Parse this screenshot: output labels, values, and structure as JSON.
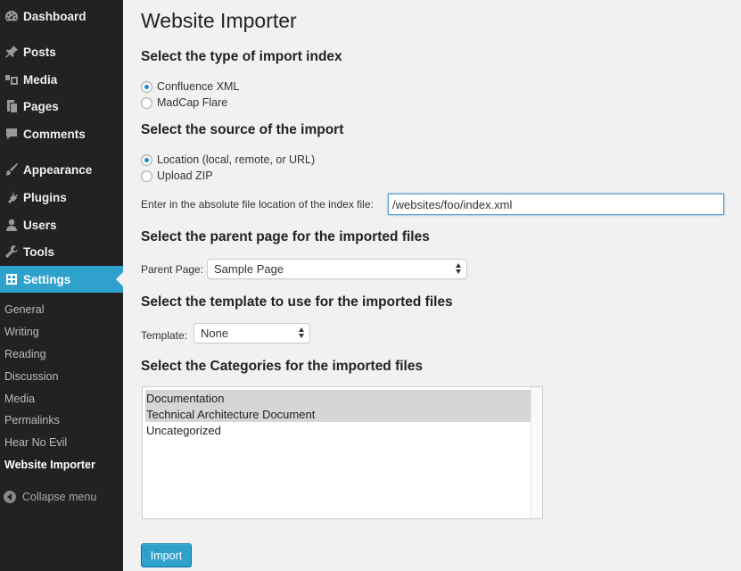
{
  "sidebar": {
    "menu": [
      {
        "label": "Dashboard",
        "icon": "dashboard-icon"
      },
      {
        "label": "Posts",
        "icon": "pin-icon"
      },
      {
        "label": "Media",
        "icon": "media-icon"
      },
      {
        "label": "Pages",
        "icon": "pages-icon"
      },
      {
        "label": "Comments",
        "icon": "comment-icon"
      },
      {
        "label": "Appearance",
        "icon": "brush-icon"
      },
      {
        "label": "Plugins",
        "icon": "plugin-icon"
      },
      {
        "label": "Users",
        "icon": "user-icon"
      },
      {
        "label": "Tools",
        "icon": "wrench-icon"
      },
      {
        "label": "Settings",
        "icon": "settings-icon"
      }
    ],
    "submenu": [
      "General",
      "Writing",
      "Reading",
      "Discussion",
      "Media",
      "Permalinks",
      "Hear No Evil",
      "Website Importer"
    ],
    "current_submenu": "Website Importer",
    "collapse_label": "Collapse menu",
    "accent_color": "#2ea2cc"
  },
  "main": {
    "title": "Website Importer",
    "import_type": {
      "heading": "Select the type of import index",
      "options": [
        "Confluence XML",
        "MadCap Flare"
      ],
      "selected": "Confluence XML"
    },
    "source": {
      "heading": "Select the source of the import",
      "options": [
        "Location (local, remote, or URL)",
        "Upload ZIP"
      ],
      "selected": "Location (local, remote, or URL)",
      "file_label": "Enter in the absolute file location of the index file:",
      "file_value": "/websites/foo/index.xml"
    },
    "parent": {
      "heading": "Select the parent page for the imported files",
      "label": "Parent Page:",
      "value": "Sample Page"
    },
    "template": {
      "heading": "Select the template to use for the imported files",
      "label": "Template:",
      "value": "None"
    },
    "categories": {
      "heading": "Select the Categories for the imported files",
      "options": [
        "Documentation",
        "Technical Architecture Document",
        "Uncategorized"
      ],
      "selected": [
        "Documentation",
        "Technical Architecture Document"
      ]
    },
    "import_button": "Import"
  }
}
